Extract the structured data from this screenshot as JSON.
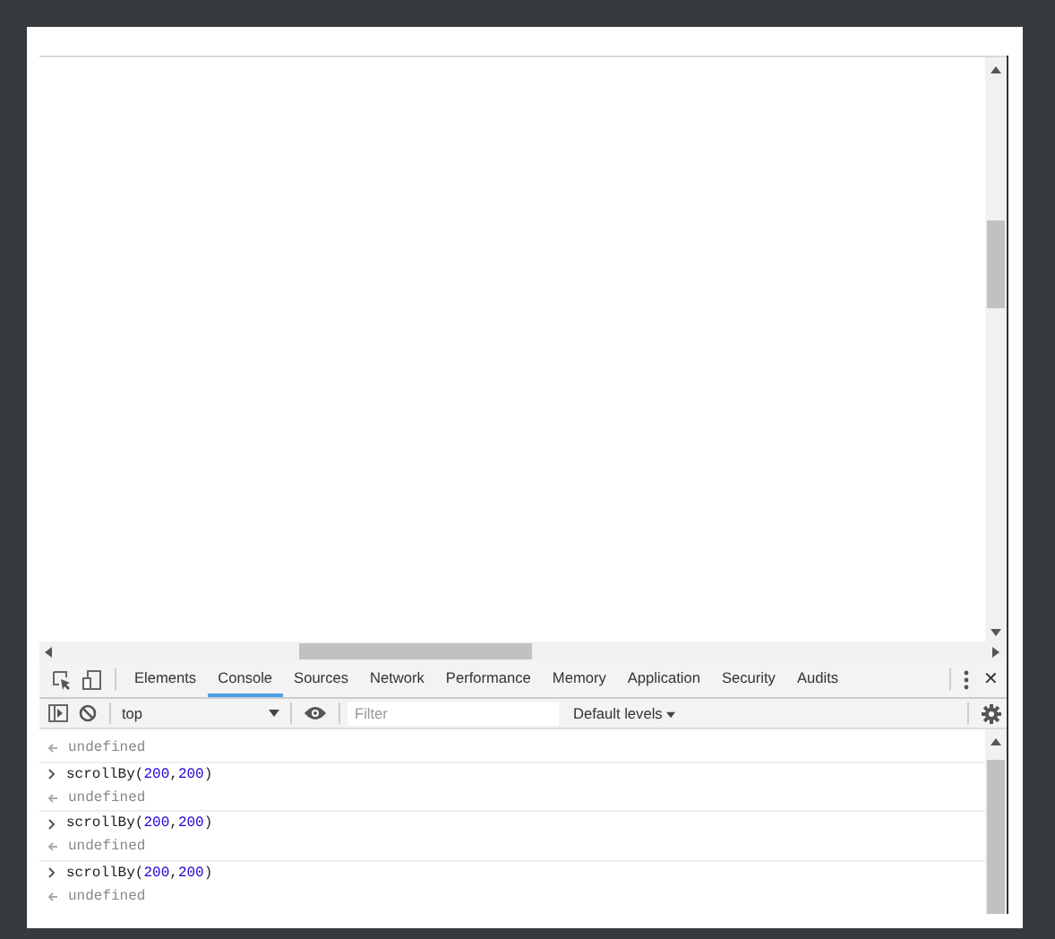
{
  "devtools": {
    "tabs": [
      {
        "label": "Elements",
        "selected": false
      },
      {
        "label": "Console",
        "selected": true
      },
      {
        "label": "Sources",
        "selected": false
      },
      {
        "label": "Network",
        "selected": false
      },
      {
        "label": "Performance",
        "selected": false
      },
      {
        "label": "Memory",
        "selected": false
      },
      {
        "label": "Application",
        "selected": false
      },
      {
        "label": "Security",
        "selected": false
      },
      {
        "label": "Audits",
        "selected": false
      }
    ],
    "close_glyph": "✕",
    "context": "top",
    "filter": {
      "placeholder": "Filter"
    },
    "levels": "Default levels",
    "messages": [
      {
        "kind": "output",
        "segments": [
          {
            "kind": "plain",
            "text": "undefined"
          }
        ]
      },
      {
        "kind": "input",
        "segments": [
          {
            "kind": "plain",
            "text": "scrollBy("
          },
          {
            "kind": "number",
            "text": "200"
          },
          {
            "kind": "plain",
            "text": ","
          },
          {
            "kind": "number",
            "text": "200"
          },
          {
            "kind": "plain",
            "text": ")"
          }
        ]
      },
      {
        "kind": "output",
        "segments": [
          {
            "kind": "plain",
            "text": "undefined"
          }
        ]
      },
      {
        "kind": "input",
        "segments": [
          {
            "kind": "plain",
            "text": "scrollBy("
          },
          {
            "kind": "number",
            "text": "200"
          },
          {
            "kind": "plain",
            "text": ","
          },
          {
            "kind": "number",
            "text": "200"
          },
          {
            "kind": "plain",
            "text": ")"
          }
        ]
      },
      {
        "kind": "output",
        "segments": [
          {
            "kind": "plain",
            "text": "undefined"
          }
        ]
      },
      {
        "kind": "input",
        "segments": [
          {
            "kind": "plain",
            "text": "scrollBy("
          },
          {
            "kind": "number",
            "text": "200"
          },
          {
            "kind": "plain",
            "text": ","
          },
          {
            "kind": "number",
            "text": "200"
          },
          {
            "kind": "plain",
            "text": ")"
          }
        ]
      },
      {
        "kind": "output",
        "segments": [
          {
            "kind": "plain",
            "text": "undefined"
          }
        ]
      }
    ]
  }
}
